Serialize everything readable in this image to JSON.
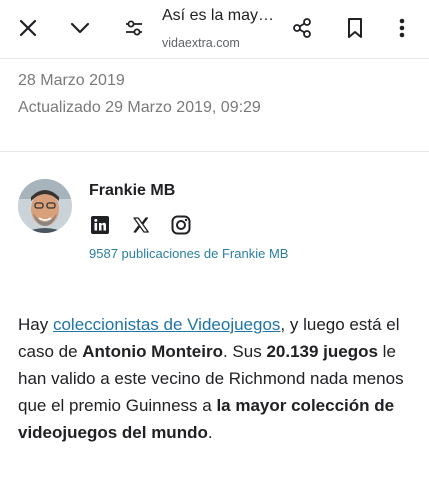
{
  "toolbar": {
    "title": "Así es la may…",
    "url": "vidaextra.com",
    "icons": [
      "close-icon",
      "chevron-down-icon",
      "page-settings-icon",
      "share-icon",
      "bookmark-icon",
      "more-vert-icon"
    ]
  },
  "dates": {
    "published": "28 Marzo 2019",
    "updated": "Actualizado 29 Marzo 2019, 09:29"
  },
  "author": {
    "name": "Frankie MB",
    "publications": "9587 publicaciones de Frankie MB",
    "social": [
      "linkedin-icon",
      "x-icon",
      "instagram-icon"
    ]
  },
  "article": {
    "p1": "Hay ",
    "link": "coleccionistas de Videojuegos",
    "p2": ", y luego está el caso de ",
    "b1": "Antonio Monteiro",
    "p3": ". Sus ",
    "b2": "20.139 juegos",
    "p4": " le han valido a este vecino de  Richmond  nada menos que el premio Guinness a ",
    "b3": "la mayor colección de videojuegos del mundo",
    "p5": "."
  },
  "colors": {
    "link": "#1f74a8",
    "pubs": "#2a7fa0",
    "muted": "#7a7a7a",
    "text": "#202124"
  }
}
